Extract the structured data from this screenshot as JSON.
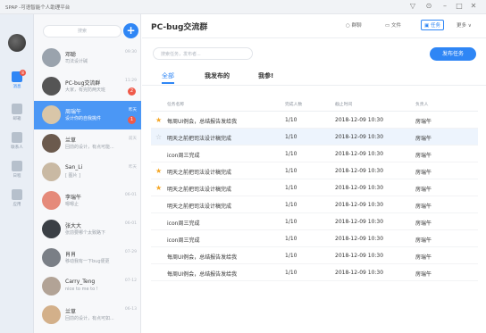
{
  "app_title": "SPAP -可语智能个人助理平台",
  "window_controls": [
    "▽",
    "⊙",
    "–",
    "□",
    "✕"
  ],
  "rail": {
    "items": [
      {
        "icon": "chat-icon",
        "label": "消息",
        "active": true,
        "badge": "8"
      },
      {
        "icon": "mail-icon",
        "label": "邮箱",
        "active": false
      },
      {
        "icon": "contacts-icon",
        "label": "联系人",
        "active": false
      },
      {
        "icon": "calendar-icon",
        "label": "日程",
        "active": false
      },
      {
        "icon": "apps-icon",
        "label": "应用",
        "active": false
      }
    ]
  },
  "search": {
    "placeholder": "搜索"
  },
  "conversations": [
    {
      "name": "邓聪",
      "msg": "司法设计碱",
      "time": "09:30",
      "active": false,
      "badge": "",
      "avatar": "#9aa3ad"
    },
    {
      "name": "PC-bug交流群",
      "msg": "大家，有完防两天班",
      "time": "11:29",
      "active": false,
      "badge": "2",
      "avatar": "#555555"
    },
    {
      "name": "周瑞午",
      "msg": "设计你的自我挑件",
      "time": "昨天",
      "active": true,
      "badge": "1",
      "avatar": "#d9c6a8"
    },
    {
      "name": "兰草",
      "msg": "回前的设计，有点可能...",
      "time": "前天",
      "active": false,
      "badge": "",
      "avatar": "#6b5a4d"
    },
    {
      "name": "San_Li",
      "msg": "[ 图片 ]",
      "time": "昨天",
      "active": false,
      "badge": "",
      "avatar": "#c9b9a3"
    },
    {
      "name": "李瑞午",
      "msg": "嗯嗯止",
      "time": "06-01",
      "active": false,
      "badge": "",
      "avatar": "#e58a7a"
    },
    {
      "name": "张大大",
      "msg": "张前要哪个太致路下",
      "time": "06-01",
      "active": false,
      "badge": "",
      "avatar": "#3a3f45"
    },
    {
      "name": "肖肖",
      "msg": "移动我有一下bug便更",
      "time": "07-29",
      "active": false,
      "badge": "",
      "avatar": "#7a7f86"
    },
    {
      "name": "Carry_Teng",
      "msg": "nice to me to !",
      "time": "07-12",
      "active": false,
      "badge": "",
      "avatar": "#b2a396"
    },
    {
      "name": "兰草",
      "msg": "回前的设计，有点可如...",
      "time": "06-13",
      "active": false,
      "badge": "",
      "avatar": "#d3b08a"
    }
  ],
  "main": {
    "title": "PC-bug交流群",
    "toolbar": [
      {
        "icon": "chat-bubble-icon",
        "label": "群聊",
        "active": false
      },
      {
        "icon": "folder-icon",
        "label": "文件",
        "active": false
      },
      {
        "icon": "task-icon",
        "label": "任务",
        "active": true
      },
      {
        "icon": "chevron-down-icon",
        "label": "更多",
        "active": false
      }
    ],
    "task_search_placeholder": "搜索任务，发布者...",
    "publish_button": "发布任务",
    "tabs": [
      {
        "label": "全部",
        "active": true
      },
      {
        "label": "我发布的",
        "active": false
      },
      {
        "label": "我参!",
        "active": false
      }
    ],
    "columns": [
      "任务名称",
      "完成人数",
      "截止时间",
      "负责人"
    ],
    "rows": [
      {
        "star": "filled",
        "name": "每周UI例会，总结报告发给我",
        "count": "1/10",
        "deadline": "2018-12-09  10:30",
        "owner": "房瑞午"
      },
      {
        "star": "outline",
        "name": "明天之前把司法设计稿完成",
        "count": "1/10",
        "deadline": "2018-12-09  10:30",
        "owner": "房瑞午"
      },
      {
        "star": "",
        "name": "icon周三完成",
        "count": "1/10",
        "deadline": "2018-12-09  10:30",
        "owner": "房瑞午"
      },
      {
        "star": "filled",
        "name": "明天之前把司法设计稿完成",
        "count": "1/10",
        "deadline": "2018-12-09  10:30",
        "owner": "房瑞午"
      },
      {
        "star": "filled",
        "name": "明天之前把司法设计稿完成",
        "count": "1/10",
        "deadline": "2018-12-09  10:30",
        "owner": "房瑞午"
      },
      {
        "star": "",
        "name": "明天之前把司法设计稿完成",
        "count": "1/10",
        "deadline": "2018-12-09  10:30",
        "owner": "房瑞午"
      },
      {
        "star": "",
        "name": "icon周三完成",
        "count": "1/10",
        "deadline": "2018-12-09  10:30",
        "owner": "房瑞午"
      },
      {
        "star": "",
        "name": "icon周三完成",
        "count": "1/10",
        "deadline": "2018-12-09  10:30",
        "owner": "房瑞午"
      },
      {
        "star": "",
        "name": "每周UI例会，总结报告发给我",
        "count": "1/10",
        "deadline": "2018-12-09  10:30",
        "owner": "房瑞午"
      },
      {
        "star": "",
        "name": "每周UI例会，总结报告发给我",
        "count": "1/10",
        "deadline": "2018-12-09  10:30",
        "owner": "房瑞午"
      }
    ],
    "highlight_row": 1
  }
}
